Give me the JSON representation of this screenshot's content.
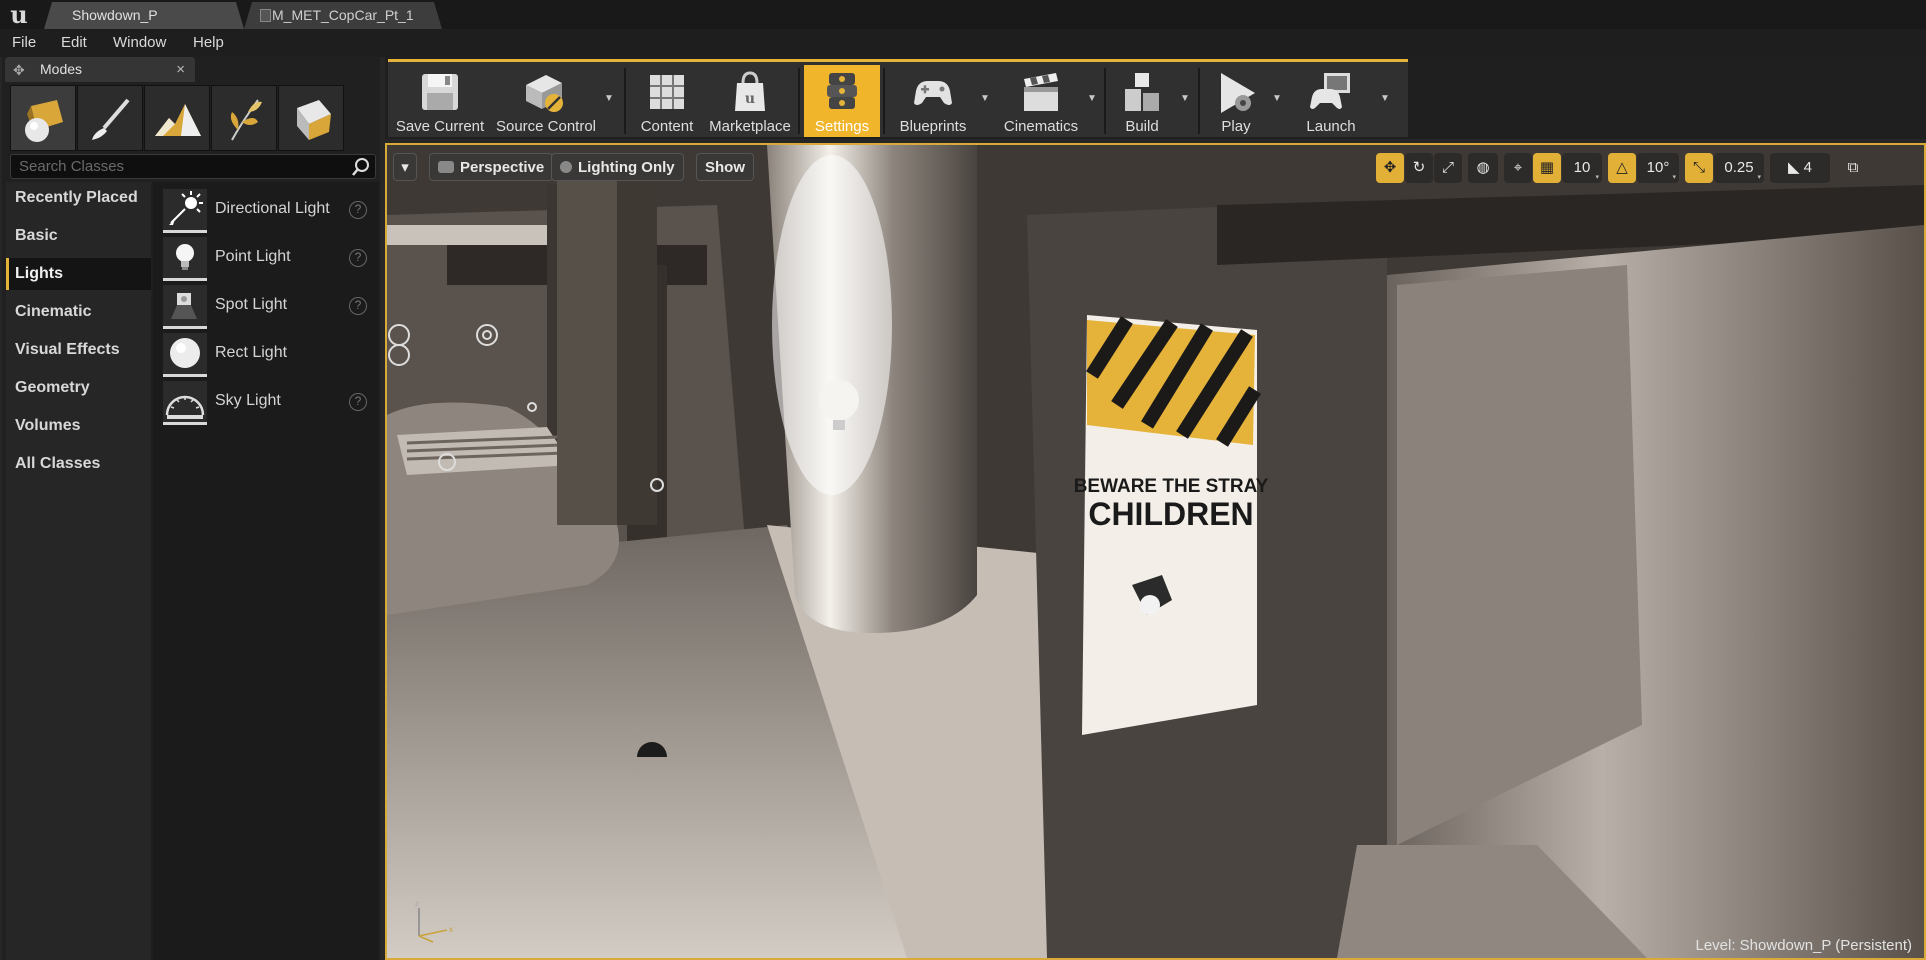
{
  "tabs": [
    {
      "label": "Showdown_P",
      "active": true
    },
    {
      "label": "M_MET_CopCar_Pt_1",
      "active": false
    }
  ],
  "menu": [
    "File",
    "Edit",
    "Window",
    "Help"
  ],
  "modes": {
    "tab_label": "Modes",
    "close_glyph": "×",
    "search_placeholder": "Search Classes",
    "categories": [
      "Recently Placed",
      "Basic",
      "Lights",
      "Cinematic",
      "Visual Effects",
      "Geometry",
      "Volumes",
      "All Classes"
    ],
    "active_category": "Lights",
    "placeables": [
      {
        "name": "Directional Light",
        "icon": "directional-light-icon"
      },
      {
        "name": "Point Light",
        "icon": "point-light-icon"
      },
      {
        "name": "Spot Light",
        "icon": "spot-light-icon"
      },
      {
        "name": "Rect Light",
        "icon": "rect-light-icon"
      },
      {
        "name": "Sky Light",
        "icon": "sky-light-icon"
      }
    ],
    "help_glyph": "?"
  },
  "toolbar": {
    "buttons": [
      {
        "label": "Save Current",
        "icon": "floppy-disk-icon"
      },
      {
        "label": "Source Control",
        "icon": "source-control-icon"
      },
      {
        "label": "Content",
        "icon": "content-browser-icon"
      },
      {
        "label": "Marketplace",
        "icon": "marketplace-icon"
      },
      {
        "label": "Settings",
        "icon": "settings-gear-icon",
        "active": true
      },
      {
        "label": "Blueprints",
        "icon": "blueprints-gamepad-icon"
      },
      {
        "label": "Cinematics",
        "icon": "clapperboard-icon"
      },
      {
        "label": "Build",
        "icon": "build-blocks-icon"
      },
      {
        "label": "Play",
        "icon": "play-icon"
      },
      {
        "label": "Launch",
        "icon": "launch-icon"
      }
    ],
    "dropdown_glyph": "▼"
  },
  "viewport": {
    "menu_glyph": "▾",
    "perspective_label": "Perspective",
    "lighting_label": "Lighting Only",
    "show_label": "Show",
    "grid_snap_value": "10",
    "rotation_snap_value": "10°",
    "scale_snap_value": "0.25",
    "camera_speed_value": "4",
    "poster_line1": "BEWARE THE STRAY",
    "poster_line2": "CHILDREN",
    "level_label": "Level:  Showdown_P (Persistent)"
  },
  "colors": {
    "accent": "#e5b33a",
    "panel_bg": "#202020",
    "viewport_bg": "#4d4743"
  }
}
